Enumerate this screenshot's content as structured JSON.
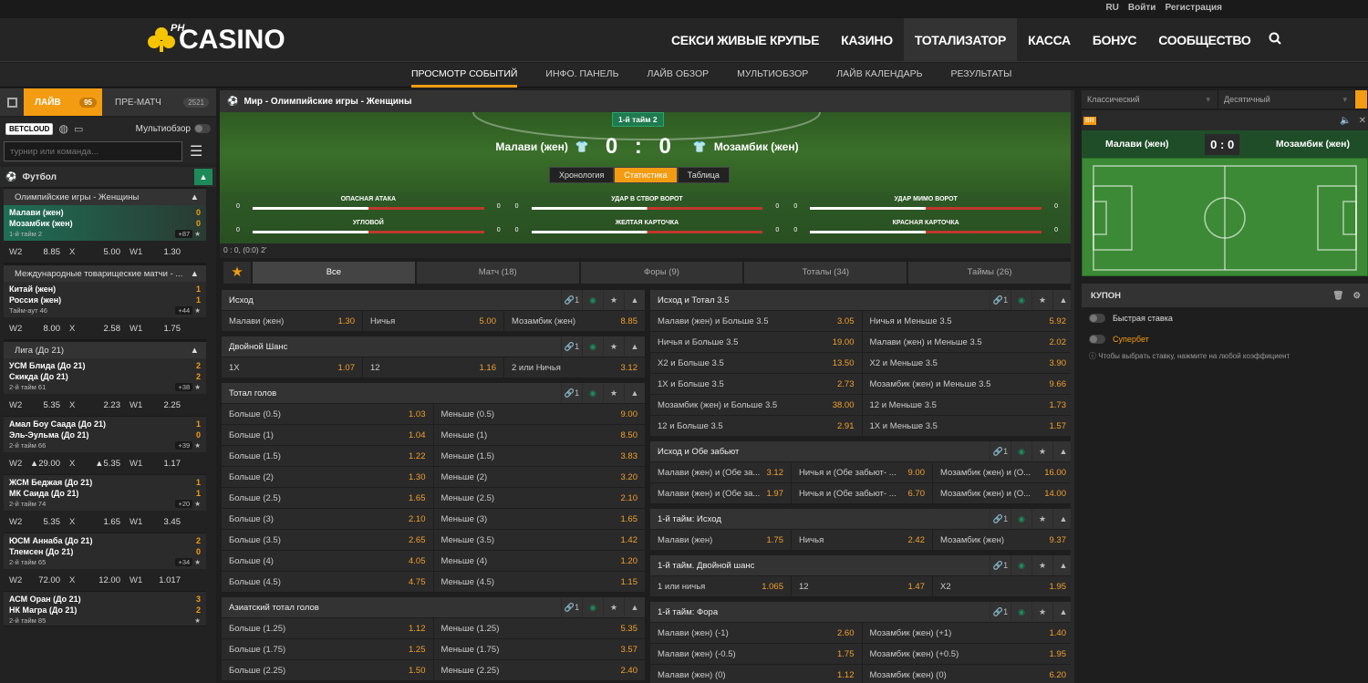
{
  "top": {
    "lang": "RU",
    "login": "Войти",
    "register": "Регистрация"
  },
  "logo": {
    "ph": "PH",
    "text": "CASINO"
  },
  "nav": [
    "СЕКСИ ЖИВЫЕ КРУПЬЕ",
    "КАЗИНО",
    "ТОТАЛИЗАТОР",
    "КАССА",
    "БОНУС",
    "СООБЩЕСТВО"
  ],
  "subnav": [
    "ПРОСМОТР СОБЫТИЙ",
    "ИНФО. ПАНЕЛЬ",
    "ЛАЙВ ОБЗОР",
    "МУЛЬТИОБЗОР",
    "ЛАЙВ КАЛЕНДАРЬ",
    "РЕЗУЛЬТАТЫ"
  ],
  "left": {
    "live": "ЛАЙВ",
    "live_count": "95",
    "pre": "ПРЕ-МАТЧ",
    "pre_count": "2521",
    "betcloud": "BETCLOUD",
    "multi": "Мультиобзор",
    "search_placeholder": "турнир или команда...",
    "sport": "Футбол",
    "leagues": [
      {
        "name": "Олимпийские игры - Женщины",
        "matches": [
          {
            "t1": "Малави (жен)",
            "t2": "Мозамбик (жен)",
            "s1": "0",
            "s2": "0",
            "status": "1-й тайм  2",
            "plus": "+87",
            "o": [
              [
                "W2",
                "8.85"
              ],
              [
                "X",
                "5.00"
              ],
              [
                "W1",
                "1.30"
              ]
            ],
            "sel": true
          }
        ]
      },
      {
        "name": "Международные товарищеские матчи - ...",
        "matches": [
          {
            "t1": "Китай (жен)",
            "t2": "Россия (жен)",
            "s1": "1",
            "s2": "1",
            "status": "Тайм-аут  46",
            "plus": "+44",
            "o": [
              [
                "W2",
                "8.00"
              ],
              [
                "X",
                "2.58"
              ],
              [
                "W1",
                "1.75"
              ]
            ]
          }
        ]
      },
      {
        "name": "Лига (До 21)",
        "matches": [
          {
            "t1": "УСМ Блида (До 21)",
            "t2": "Скикда (До 21)",
            "s1": "2",
            "s2": "2",
            "status": "2-й тайм  61",
            "plus": "+38",
            "o": [
              [
                "W2",
                "5.35"
              ],
              [
                "X",
                "2.23"
              ],
              [
                "W1",
                "2.25"
              ]
            ]
          },
          {
            "t1": "Амал Боу Саада (До 21)",
            "t2": "Эль-Эульма (До 21)",
            "s1": "1",
            "s2": "0",
            "status": "2-й тайм  66",
            "plus": "+39",
            "o": [
              [
                "W2",
                "▲29.00"
              ],
              [
                "X",
                "▲5.35"
              ],
              [
                "W1",
                "1.17"
              ]
            ]
          },
          {
            "t1": "ЖСМ Беджая (До 21)",
            "t2": "МК Саида (До 21)",
            "s1": "1",
            "s2": "1",
            "status": "2-й тайм  74",
            "plus": "+20",
            "o": [
              [
                "W2",
                "5.35"
              ],
              [
                "X",
                "1.65"
              ],
              [
                "W1",
                "3.45"
              ]
            ]
          },
          {
            "t1": "ЮСМ Аннаба (До 21)",
            "t2": "Тлемсен (До 21)",
            "s1": "2",
            "s2": "0",
            "status": "2-й тайм  65",
            "plus": "+34",
            "o": [
              [
                "W2",
                "72.00"
              ],
              [
                "X",
                "12.00"
              ],
              [
                "W1",
                "1.017"
              ]
            ]
          },
          {
            "t1": "АСМ Оран (До 21)",
            "t2": "НК Магра (До 21)",
            "s1": "3",
            "s2": "2",
            "status": "2-й тайм  85",
            "plus": "",
            "o": []
          }
        ]
      }
    ]
  },
  "event": {
    "title": "Мир - Олимпийские игры - Женщины",
    "half": "1-й тайм 2",
    "team1": "Малави (жен)",
    "team2": "Мозамбик (жен)",
    "score": "0 : 0",
    "tabs": [
      "Хронология",
      "Статистика",
      "Таблица"
    ],
    "stats": [
      [
        "ОПАСНАЯ АТАКА",
        "0",
        "0"
      ],
      [
        "УДАР В СТВОР ВОРОТ",
        "0",
        "0"
      ],
      [
        "УДАР МИМО ВОРОТ",
        "0",
        "0"
      ],
      [
        "УГЛОВОЙ",
        "0",
        "0"
      ],
      [
        "ЖЕЛТАЯ КАРТОЧКА",
        "0",
        "0"
      ],
      [
        "КРАСНАЯ КАРТОЧКА",
        "0",
        "0"
      ]
    ],
    "scoreline": "0 : 0, (0:0) 2'"
  },
  "mtabs": [
    "Все",
    "Матч (18)",
    "Форы (9)",
    "Тоталы (34)",
    "Таймы (26)"
  ],
  "col1": [
    {
      "h": "Исход",
      "rows": [
        [
          [
            "Малави (жен)",
            "1.30"
          ],
          [
            "Ничья",
            "5.00"
          ],
          [
            "Мозамбик (жен)",
            "8.85"
          ]
        ]
      ]
    },
    {
      "h": "Двойной Шанс",
      "rows": [
        [
          [
            "1X",
            "1.07"
          ],
          [
            "12",
            "1.16"
          ],
          [
            "2 или Ничья",
            "3.12"
          ]
        ]
      ]
    },
    {
      "h": "Тотал голов",
      "rows": [
        [
          [
            "Больше (0.5)",
            "1.03"
          ],
          [
            "Меньше (0.5)",
            "9.00"
          ]
        ],
        [
          [
            "Больше (1)",
            "1.04"
          ],
          [
            "Меньше (1)",
            "8.50"
          ]
        ],
        [
          [
            "Больше (1.5)",
            "1.22"
          ],
          [
            "Меньше (1.5)",
            "3.83"
          ]
        ],
        [
          [
            "Больше (2)",
            "1.30"
          ],
          [
            "Меньше (2)",
            "3.20"
          ]
        ],
        [
          [
            "Больше (2.5)",
            "1.65"
          ],
          [
            "Меньше (2.5)",
            "2.10"
          ]
        ],
        [
          [
            "Больше (3)",
            "2.10"
          ],
          [
            "Меньше (3)",
            "1.65"
          ]
        ],
        [
          [
            "Больше (3.5)",
            "2.65"
          ],
          [
            "Меньше (3.5)",
            "1.42"
          ]
        ],
        [
          [
            "Больше (4)",
            "4.05"
          ],
          [
            "Меньше (4)",
            "1.20"
          ]
        ],
        [
          [
            "Больше (4.5)",
            "4.75"
          ],
          [
            "Меньше (4.5)",
            "1.15"
          ]
        ]
      ]
    },
    {
      "h": "Азиатский тотал голов",
      "rows": [
        [
          [
            "Больше (1.25)",
            "1.12"
          ],
          [
            "Меньше (1.25)",
            "5.35"
          ]
        ],
        [
          [
            "Больше (1.75)",
            "1.25"
          ],
          [
            "Меньше (1.75)",
            "3.57"
          ]
        ],
        [
          [
            "Больше (2.25)",
            "1.50"
          ],
          [
            "Меньше (2.25)",
            "2.40"
          ]
        ]
      ]
    }
  ],
  "col2": [
    {
      "h": "Исход и Тотал 3.5",
      "rows": [
        [
          [
            "Малави (жен) и Больше 3.5",
            "3.05"
          ],
          [
            "Ничья и Меньше 3.5",
            "5.92"
          ]
        ],
        [
          [
            "Ничья и Больше 3.5",
            "19.00"
          ],
          [
            "Малави (жен) и Меньше 3.5",
            "2.02"
          ]
        ],
        [
          [
            "X2 и Больше 3.5",
            "13.50"
          ],
          [
            "X2 и Меньше 3.5",
            "3.90"
          ]
        ],
        [
          [
            "1X и Больше 3.5",
            "2.73"
          ],
          [
            "Мозамбик (жен) и Меньше 3.5",
            "9.66"
          ]
        ],
        [
          [
            "Мозамбик (жен) и Больше 3.5",
            "38.00"
          ],
          [
            "12 и Меньше 3.5",
            "1.73"
          ]
        ],
        [
          [
            "12 и Больше 3.5",
            "2.91"
          ],
          [
            "1X и Меньше 3.5",
            "1.57"
          ]
        ]
      ]
    },
    {
      "h": "Исход и Обе забьют",
      "rows": [
        [
          [
            "Малави (жен) и (Обе за...",
            "3.12"
          ],
          [
            "Ничья и (Обе забьют- ...",
            "9.00"
          ],
          [
            "Мозамбик (жен) и (О...",
            "16.00"
          ]
        ],
        [
          [
            "Малави (жен) и (Обе за...",
            "1.97"
          ],
          [
            "Ничья и (Обе забьют- ...",
            "6.70"
          ],
          [
            "Мозамбик (жен) и (О...",
            "14.00"
          ]
        ]
      ]
    },
    {
      "h": "1-й тайм: Исход",
      "rows": [
        [
          [
            "Малави (жен)",
            "1.75"
          ],
          [
            "Ничья",
            "2.42"
          ],
          [
            "Мозамбик (жен)",
            "9.37"
          ]
        ]
      ]
    },
    {
      "h": "1-й тайм. Двойной шанс",
      "rows": [
        [
          [
            "1 или ничья",
            "1.065"
          ],
          [
            "12",
            "1.47"
          ],
          [
            "X2",
            "1.95"
          ]
        ]
      ]
    },
    {
      "h": "1-й тайм: Фора",
      "rows": [
        [
          [
            "Малави (жен) (-1)",
            "2.60"
          ],
          [
            "Мозамбик (жен) (+1)",
            "1.40"
          ]
        ],
        [
          [
            "Малави (жен) (-0.5)",
            "1.75"
          ],
          [
            "Мозамбик (жен) (+0.5)",
            "1.95"
          ]
        ],
        [
          [
            "Малави (жен) (0)",
            "1.12"
          ],
          [
            "Мозамбик (жен) (0)",
            "6.20"
          ]
        ]
      ]
    }
  ],
  "right": {
    "sel1": "Классический",
    "sel2": "Десятичный",
    "brl": "BR",
    "team1": "Малави (жен)",
    "team2": "Мозамбик (жен)",
    "score": "0 : 0",
    "coupon": "КУПОН",
    "quick": "Быстрая ставка",
    "super": "Супербет",
    "hint": "Чтобы выбрать ставку, нажмите на любой коэффициент"
  }
}
